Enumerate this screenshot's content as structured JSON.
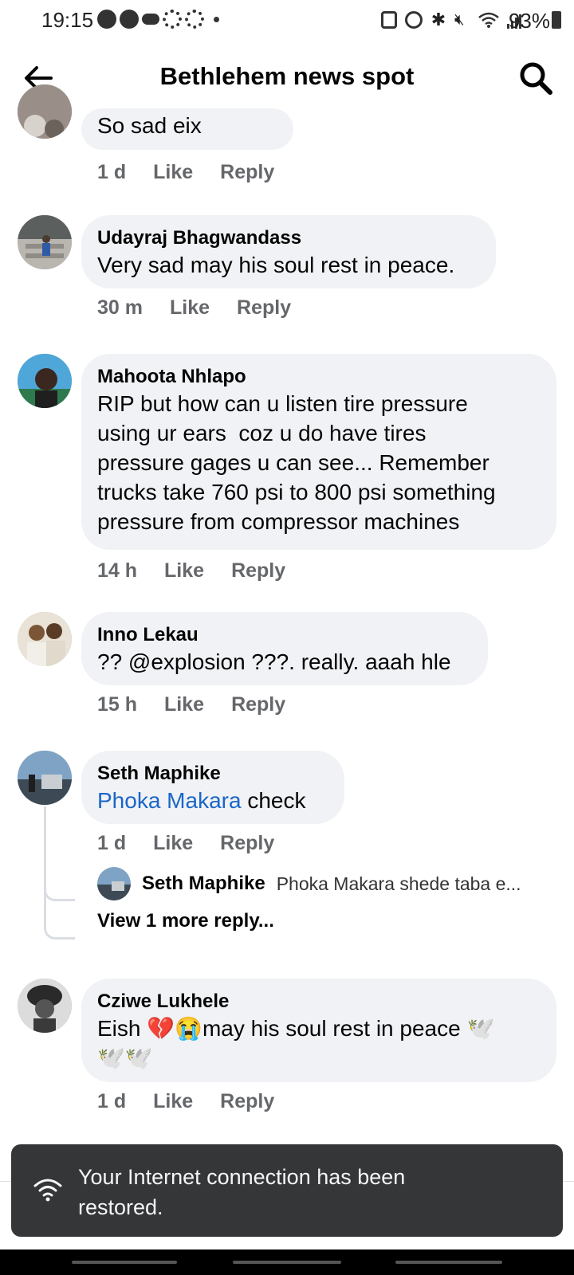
{
  "status_bar": {
    "time": "19:15",
    "battery": "93%"
  },
  "header": {
    "title": "Bethlehem news spot"
  },
  "comments": [
    {
      "text": "So sad eix",
      "time": "1 d",
      "like": "Like",
      "reply": "Reply"
    },
    {
      "author": "Udayraj Bhagwandass",
      "text": "Very sad may his soul rest in peace.",
      "time": "30 m",
      "like": "Like",
      "reply": "Reply"
    },
    {
      "author": "Mahoota Nhlapo",
      "lines": [
        "RIP but how can u listen tire pressure",
        "using ur ears  coz u do have tires",
        "pressure gages u can see... Remember",
        "trucks take 760 psi to 800 psi something",
        "pressure from compressor machines"
      ],
      "time": "14 h",
      "like": "Like",
      "reply": "Reply"
    },
    {
      "author": "Inno Lekau",
      "text": "?? @explosion ???. really. aaah hle",
      "time": "15 h",
      "like": "Like",
      "reply": "Reply"
    },
    {
      "author": "Seth Maphike",
      "mention": "Phoka Makara",
      "text": " check",
      "time": "1 d",
      "like": "Like",
      "reply": "Reply"
    },
    {
      "author": "Cziwe Lukhele",
      "text": "Eish 💔😭may his soul rest in peace 🕊️",
      "text2": "🕊️🕊️",
      "time": "1 d",
      "like": "Like",
      "reply": "Reply"
    }
  ],
  "reply_preview": {
    "author": "Seth Maphike",
    "text": "Phoka Makara shede taba e...",
    "view_more": "View 1 more reply..."
  },
  "toast": {
    "line1": "Your Internet connection has been",
    "line2": "restored."
  },
  "icons": {
    "back": "arrow-left-icon",
    "search": "search-icon",
    "toast": "wifi-icon"
  }
}
